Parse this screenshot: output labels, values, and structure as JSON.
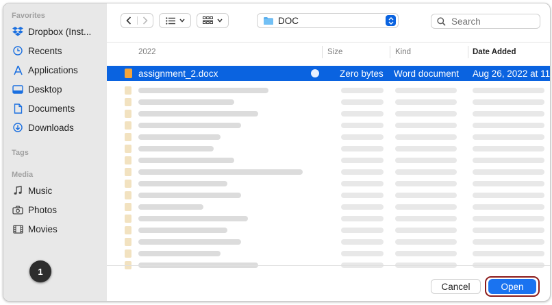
{
  "sidebar": {
    "favorites_title": "Favorites",
    "favorites": [
      {
        "label": "Dropbox (Inst...",
        "icon": "dropbox-icon"
      },
      {
        "label": "Recents",
        "icon": "clock-icon"
      },
      {
        "label": "Applications",
        "icon": "applications-icon"
      },
      {
        "label": "Desktop",
        "icon": "desktop-icon"
      },
      {
        "label": "Documents",
        "icon": "document-icon"
      },
      {
        "label": "Downloads",
        "icon": "download-icon"
      }
    ],
    "tags_title": "Tags",
    "media_title": "Media",
    "media": [
      {
        "label": "Music",
        "icon": "music-icon"
      },
      {
        "label": "Photos",
        "icon": "camera-icon"
      },
      {
        "label": "Movies",
        "icon": "film-icon"
      }
    ]
  },
  "step_badge": "1",
  "toolbar": {
    "location": "DOC",
    "search_placeholder": "Search"
  },
  "list": {
    "columns": [
      "2022",
      "Size",
      "Kind",
      "Date Added"
    ],
    "selected_row": {
      "name": "assignment_2.docx",
      "size": "Zero bytes",
      "kind": "Word document",
      "date_added": "Aug 26, 2022 at 11"
    }
  },
  "footer": {
    "cancel_label": "Cancel",
    "open_label": "Open"
  },
  "colors": {
    "accent": "#0a63e0",
    "highlight_outline": "#8b1a1a",
    "sidebar_bg": "#e8e8e8"
  }
}
